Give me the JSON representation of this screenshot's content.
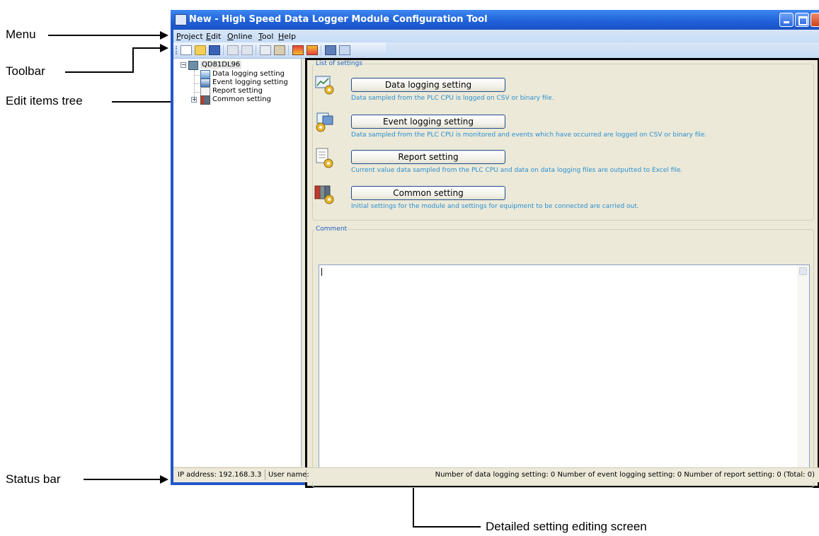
{
  "callouts": {
    "menu": "Menu",
    "toolbar": "Toolbar",
    "tree": "Edit items tree",
    "status": "Status bar",
    "detail": "Detailed setting editing screen"
  },
  "window": {
    "title": "New - High Speed Data Logger Module Configuration Tool"
  },
  "menu": [
    "Project",
    "Edit",
    "Online",
    "Tool",
    "Help"
  ],
  "toolbar_icons": [
    "new-icon",
    "open-icon",
    "save-icon",
    "import-icon",
    "export-icon",
    "copy-icon",
    "paste-icon",
    "write-icon",
    "read-icon",
    "diagnostics-icon",
    "format-icon"
  ],
  "tree": {
    "root": "QD81DL96",
    "items": [
      "Data logging setting",
      "Event logging setting",
      "Report setting",
      "Common setting"
    ]
  },
  "list_of_settings": {
    "legend": "List of settings",
    "items": [
      {
        "label": "Data logging setting",
        "desc": "Data sampled from the PLC CPU is logged on CSV or binary file."
      },
      {
        "label": "Event logging setting",
        "desc": "Data sampled from the PLC CPU is monitored and events which have occurred are logged on CSV or binary file."
      },
      {
        "label": "Report setting",
        "desc": "Current value data sampled from the PLC CPU and data on data logging files are outputted to Excel file."
      },
      {
        "label": "Common setting",
        "desc": "Initial settings for the module and settings for equipment to be connected are carried out."
      }
    ]
  },
  "comment": {
    "legend": "Comment",
    "value": ""
  },
  "status_bar": {
    "ip": "IP address: 192.168.3.3",
    "user": "User name:",
    "counts": "Number of data logging setting: 0 Number of event logging setting: 0 Number of report setting: 0 (Total: 0)"
  },
  "colors": {
    "title_bar": "#1f5fd8",
    "description_text": "#2a8fd0",
    "legend_text": "#1a5fc4"
  }
}
